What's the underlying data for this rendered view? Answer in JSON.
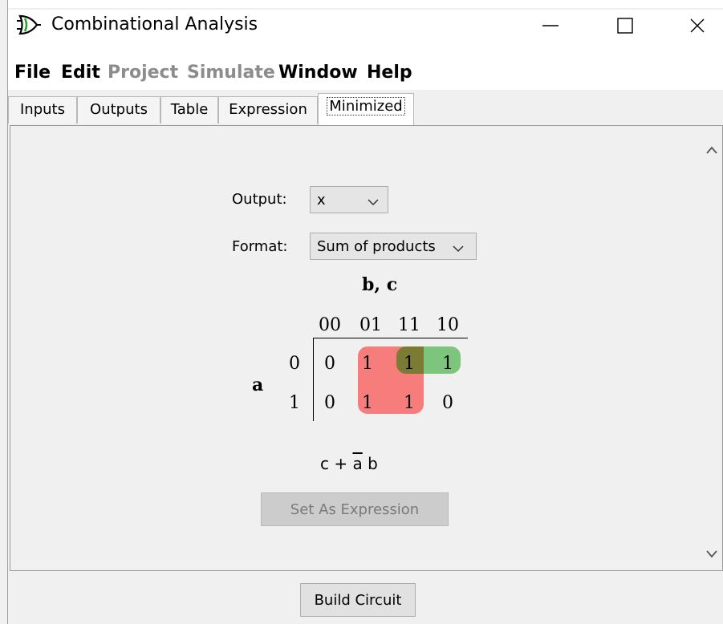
{
  "window": {
    "title": "Combinational Analysis",
    "controls": [
      "minimize",
      "maximize",
      "close"
    ]
  },
  "menu": {
    "items": [
      {
        "label": "File",
        "enabled": true
      },
      {
        "label": "Edit",
        "enabled": true
      },
      {
        "label": "Project",
        "enabled": false
      },
      {
        "label": "Simulate",
        "enabled": false
      },
      {
        "label": "Window",
        "enabled": true
      },
      {
        "label": "Help",
        "enabled": true
      }
    ]
  },
  "tabs": [
    {
      "label": "Inputs",
      "selected": false
    },
    {
      "label": "Outputs",
      "selected": false
    },
    {
      "label": "Table",
      "selected": false
    },
    {
      "label": "Expression",
      "selected": false
    },
    {
      "label": "Minimized",
      "selected": true
    }
  ],
  "minimized": {
    "output_label": "Output:",
    "output_value": "x",
    "format_label": "Format:",
    "format_value": "Sum of products",
    "kmap": {
      "column_vars": "b, c",
      "row_var": "a",
      "column_headers": [
        "00",
        "01",
        "11",
        "10"
      ],
      "row_headers": [
        "0",
        "1"
      ],
      "cells": [
        [
          "0",
          "1",
          "1",
          "1"
        ],
        [
          "0",
          "1",
          "1",
          "0"
        ]
      ],
      "group_colors": {
        "red": "#f77c7c",
        "green": "#76c276",
        "overlap": "#7c7b34"
      }
    },
    "expression": {
      "term1": "c",
      "plus": "+",
      "term2_negated": "a",
      "term2_plain": "b"
    },
    "set_expression_button": "Set As Expression"
  },
  "footer": {
    "build_button": "Build Circuit"
  }
}
